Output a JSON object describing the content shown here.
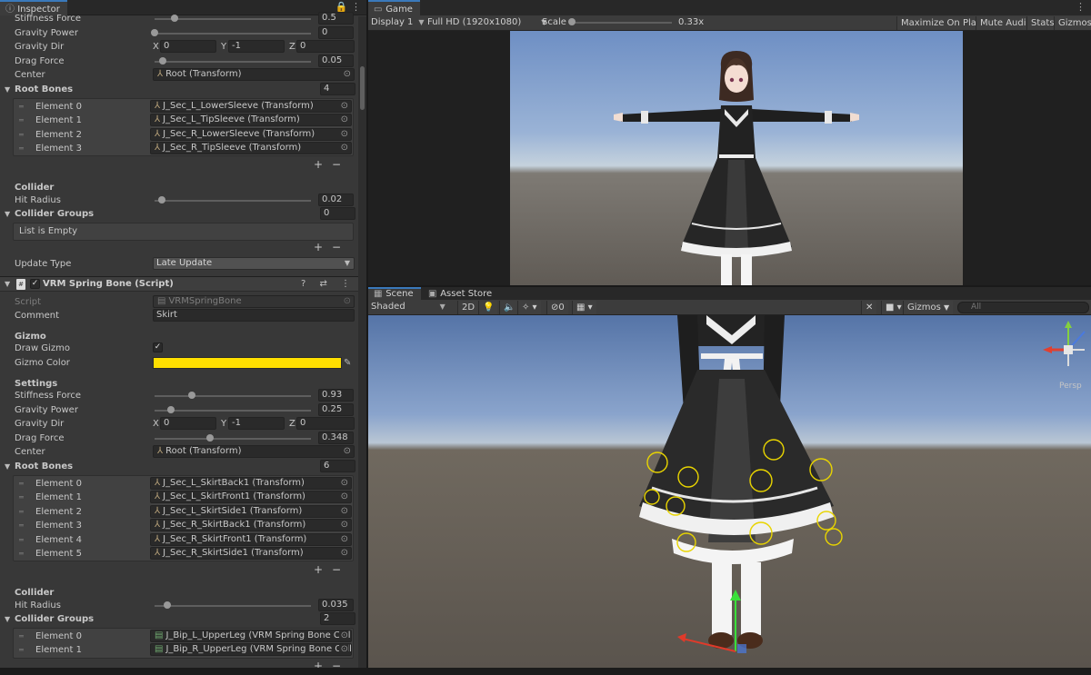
{
  "inspector": {
    "tab_label": "Inspector",
    "tab_tools": "🔒 ⋮",
    "top": {
      "stiffness_label": "Stiffness Force",
      "stiffness_value": "0.5",
      "gravity_power_label": "Gravity Power",
      "gravity_power_value": "0",
      "gravity_dir_label": "Gravity Dir",
      "gravity_dir": {
        "x_label": "X",
        "x": "0",
        "y_label": "Y",
        "y": "-1",
        "z_label": "Z",
        "z": "0"
      },
      "drag_label": "Drag Force",
      "drag_value": "0.05",
      "center_label": "Center",
      "center_value": "Root (Transform)",
      "root_bones_label": "Root Bones",
      "root_bones_count": "4",
      "root_bones": [
        {
          "label": "Element 0",
          "value": "J_Sec_L_LowerSleeve (Transform)"
        },
        {
          "label": "Element 1",
          "value": "J_Sec_L_TipSleeve (Transform)"
        },
        {
          "label": "Element 2",
          "value": "J_Sec_R_LowerSleeve (Transform)"
        },
        {
          "label": "Element 3",
          "value": "J_Sec_R_TipSleeve (Transform)"
        }
      ],
      "collider_label": "Collider",
      "hit_radius_label": "Hit Radius",
      "hit_radius_value": "0.02",
      "collider_groups_label": "Collider Groups",
      "collider_groups_count": "0",
      "list_empty": "List is Empty",
      "update_type_label": "Update Type",
      "update_type_value": "Late Update"
    },
    "component": {
      "title": "VRM Spring Bone (Script)",
      "header_icons": "? ⇄ ⋮",
      "script_label": "Script",
      "script_value": "VRMSpringBone",
      "comment_label": "Comment",
      "comment_value": "Skirt",
      "gizmo_label": "Gizmo",
      "draw_gizmo_label": "Draw Gizmo",
      "gizmo_color_label": "Gizmo Color",
      "gizmo_color": "#FFDF00",
      "settings_label": "Settings",
      "stiffness_label": "Stiffness Force",
      "stiffness_value": "0.93",
      "gravity_power_label": "Gravity Power",
      "gravity_power_value": "0.25",
      "gravity_dir_label": "Gravity Dir",
      "gravity_dir": {
        "x_label": "X",
        "x": "0",
        "y_label": "Y",
        "y": "-1",
        "z_label": "Z",
        "z": "0"
      },
      "drag_label": "Drag Force",
      "drag_value": "0.348",
      "center_label": "Center",
      "center_value": "Root (Transform)",
      "root_bones_label": "Root Bones",
      "root_bones_count": "6",
      "root_bones": [
        {
          "label": "Element 0",
          "value": "J_Sec_L_SkirtBack1 (Transform)"
        },
        {
          "label": "Element 1",
          "value": "J_Sec_L_SkirtFront1 (Transform)"
        },
        {
          "label": "Element 2",
          "value": "J_Sec_L_SkirtSide1 (Transform)"
        },
        {
          "label": "Element 3",
          "value": "J_Sec_R_SkirtBack1 (Transform)"
        },
        {
          "label": "Element 4",
          "value": "J_Sec_R_SkirtFront1 (Transform)"
        },
        {
          "label": "Element 5",
          "value": "J_Sec_R_SkirtSide1 (Transform)"
        }
      ],
      "collider_label": "Collider",
      "hit_radius_label": "Hit Radius",
      "hit_radius_value": "0.035",
      "collider_groups_label": "Collider Groups",
      "collider_groups_count": "2",
      "collider_groups": [
        {
          "label": "Element 0",
          "value": "J_Bip_L_UpperLeg (VRM Spring Bone Collider Group)"
        },
        {
          "label": "Element 1",
          "value": "J_Bip_R_UpperLeg (VRM Spring Bone Collider Group)"
        }
      ]
    },
    "plus": "+",
    "minus": "−"
  },
  "game": {
    "tab_label": "Game",
    "tab_tools": "⋮",
    "display": "Display 1",
    "resolution": "Full HD (1920x1080)",
    "scale_label": "Scale",
    "scale_value": "0.33x",
    "maximize": "Maximize On Play",
    "mute": "Mute Audio",
    "stats": "Stats",
    "gizmos": "Gizmos"
  },
  "scene": {
    "tab_label": "Scene",
    "asset_store_label": "Asset Store",
    "shading": "Shaded",
    "mode_2d": "2D",
    "hidden_count": "0",
    "gizmos": "Gizmos",
    "search_placeholder": "All",
    "persp": "Persp"
  }
}
